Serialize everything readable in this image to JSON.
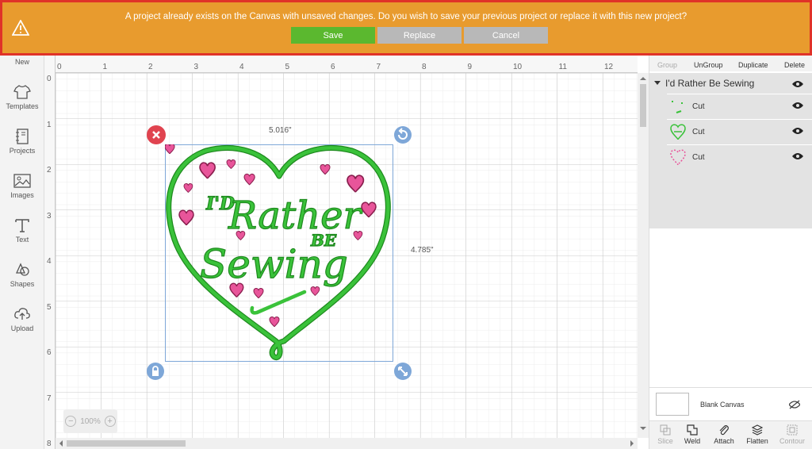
{
  "banner": {
    "message": "A project already exists on the Canvas with unsaved changes. Do you wish to save your previous project or replace it with this new project?",
    "save_label": "Save",
    "replace_label": "Replace",
    "cancel_label": "Cancel"
  },
  "leftbar": {
    "items": [
      {
        "label": "New",
        "icon": "plus-icon"
      },
      {
        "label": "Templates",
        "icon": "shirt-icon"
      },
      {
        "label": "Projects",
        "icon": "notebook-icon"
      },
      {
        "label": "Images",
        "icon": "image-icon"
      },
      {
        "label": "Text",
        "icon": "text-icon"
      },
      {
        "label": "Shapes",
        "icon": "shapes-icon"
      },
      {
        "label": "Upload",
        "icon": "upload-icon"
      }
    ]
  },
  "canvas": {
    "ruler_top": [
      "0",
      "1",
      "2",
      "3",
      "4",
      "5",
      "6",
      "7",
      "8",
      "9",
      "10",
      "11",
      "12"
    ],
    "ruler_left": [
      "0",
      "1",
      "2",
      "3",
      "4",
      "5",
      "6",
      "7",
      "8"
    ],
    "width_label": "5.016\"",
    "height_label": "4.785\"",
    "zoom": "100%",
    "design": {
      "line1": "I'D",
      "line2": "Rather",
      "line3": "BE",
      "line4": "Sewing"
    }
  },
  "rightpanel": {
    "toolbar": {
      "group": "Group",
      "ungroup": "UnGroup",
      "duplicate": "Duplicate",
      "delete": "Delete"
    },
    "group_name": "I'd Rather Be Sewing",
    "layers": [
      {
        "label": "Cut",
        "color": "#3ac23a"
      },
      {
        "label": "Cut",
        "color": "#3ac23a"
      },
      {
        "label": "Cut",
        "color": "#e8559a"
      }
    ],
    "blank_canvas": "Blank Canvas",
    "bottom": {
      "slice": "Slice",
      "weld": "Weld",
      "attach": "Attach",
      "flatten": "Flatten",
      "contour": "Contour"
    }
  },
  "colors": {
    "banner_bg": "#e89b2e",
    "banner_border": "#e03228",
    "save": "#5bb82f",
    "design_green": "#3ac23a",
    "design_pink": "#e8559a"
  }
}
